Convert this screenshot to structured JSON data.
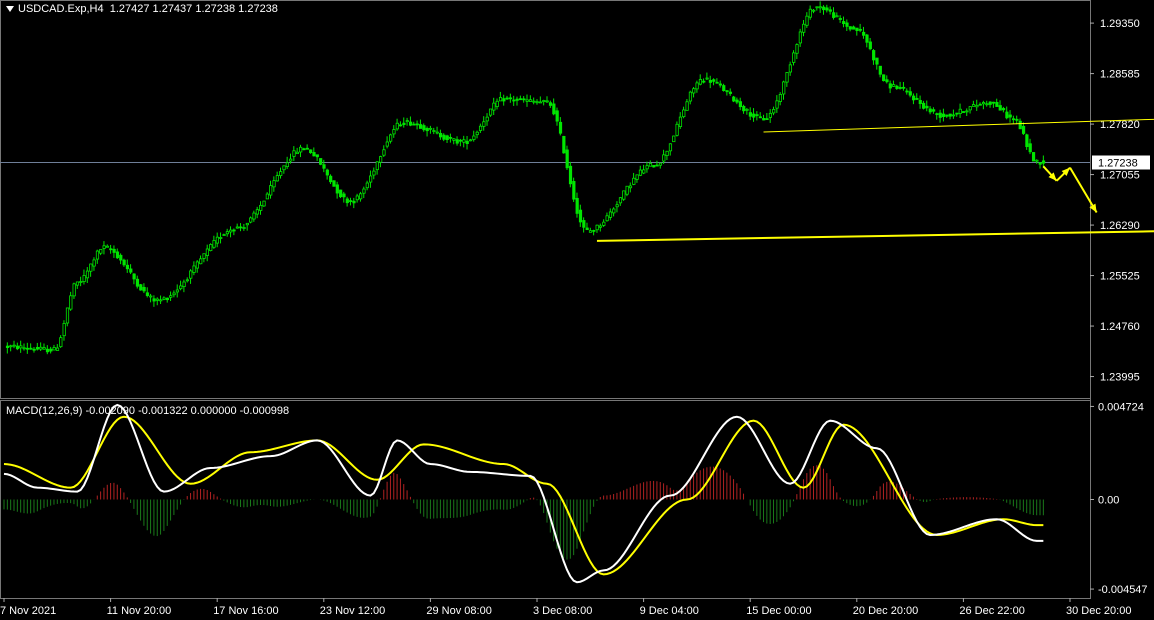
{
  "header": {
    "symbol": "USDCAD.Exp,H4",
    "ohlc": "1.27427 1.27437 1.27238 1.27238"
  },
  "macd_header": {
    "label": "MACD(12,26,9)",
    "values": "-0.002090 -0.001322 0.000000 -0.000998"
  },
  "colors": {
    "background": "#000000",
    "bull": "#00e600",
    "bear": "#00e600",
    "macd_line": "#ffffff",
    "signal_line": "#ffff00",
    "hist_pos": "#b22222",
    "hist_neg": "#1a7a1a",
    "annotation": "#ffff00",
    "price_line": "#6f7f99",
    "axis_text": "#ffffff"
  },
  "chart_data": [
    {
      "type": "candlestick",
      "title": "USDCAD.Exp,H4",
      "ylim": [
        1.2367,
        1.297
      ],
      "y_ticks": [
        "1.29350",
        "1.28585",
        "1.27820",
        "1.27055",
        "1.26290",
        "1.25525",
        "1.24760",
        "1.23995"
      ],
      "x_ticks": [
        "7 Nov 2021",
        "11 Nov 20:00",
        "17 Nov 16:00",
        "23 Nov 12:00",
        "29 Nov 08:00",
        "3 Dec 08:00",
        "9 Dec 04:00",
        "15 Dec 00:00",
        "20 Dec 20:00",
        "26 Dec 22:00",
        "30 Dec 20:00"
      ],
      "current_price": "1.27238",
      "anchors": [
        {
          "i": 0,
          "p": 1.2445
        },
        {
          "i": 15,
          "p": 1.244
        },
        {
          "i": 22,
          "p": 1.2542
        },
        {
          "i": 30,
          "p": 1.2595
        },
        {
          "i": 46,
          "p": 1.2515
        },
        {
          "i": 70,
          "p": 1.2625
        },
        {
          "i": 90,
          "p": 1.2745
        },
        {
          "i": 104,
          "p": 1.2665
        },
        {
          "i": 120,
          "p": 1.2785
        },
        {
          "i": 138,
          "p": 1.2755
        },
        {
          "i": 150,
          "p": 1.282
        },
        {
          "i": 163,
          "p": 1.2815
        },
        {
          "i": 175,
          "p": 1.262
        },
        {
          "i": 195,
          "p": 1.272
        },
        {
          "i": 210,
          "p": 1.285
        },
        {
          "i": 228,
          "p": 1.279
        },
        {
          "i": 244,
          "p": 1.296
        },
        {
          "i": 256,
          "p": 1.2925
        },
        {
          "i": 266,
          "p": 1.284
        },
        {
          "i": 282,
          "p": 1.2795
        },
        {
          "i": 296,
          "p": 1.2815
        },
        {
          "i": 303,
          "p": 1.279
        },
        {
          "i": 310,
          "p": 1.2725
        }
      ],
      "annotations": [
        {
          "kind": "trendline",
          "from": [
            228,
            1.277
          ],
          "to": [
            350,
            1.279
          ]
        },
        {
          "kind": "trendline",
          "from": [
            178,
            1.2605
          ],
          "to": [
            350,
            1.262
          ],
          "arrow": true
        },
        {
          "kind": "arrow",
          "from": [
            312,
            1.2718
          ],
          "to": [
            316,
            1.2696
          ]
        },
        {
          "kind": "arrow",
          "from": [
            316,
            1.2696
          ],
          "to": [
            320,
            1.2716
          ]
        },
        {
          "kind": "arrow",
          "from": [
            320,
            1.2716
          ],
          "to": [
            328,
            1.2648
          ]
        }
      ]
    },
    {
      "type": "macd",
      "title": "MACD(12,26,9)",
      "ylim": [
        -0.005,
        0.005
      ],
      "y_ticks": [
        "0.004724",
        "0.00",
        "-0.004547"
      ],
      "macd_anchors": [
        {
          "i": 0,
          "v": 0.0013
        },
        {
          "i": 10,
          "v": 0.0006
        },
        {
          "i": 22,
          "v": 0.0004
        },
        {
          "i": 34,
          "v": 0.0048
        },
        {
          "i": 48,
          "v": 0.0004
        },
        {
          "i": 62,
          "v": 0.0016
        },
        {
          "i": 80,
          "v": 0.0022
        },
        {
          "i": 94,
          "v": 0.003
        },
        {
          "i": 110,
          "v": 0.0002
        },
        {
          "i": 118,
          "v": 0.003
        },
        {
          "i": 128,
          "v": 0.0018
        },
        {
          "i": 140,
          "v": 0.0014
        },
        {
          "i": 158,
          "v": 0.0012
        },
        {
          "i": 172,
          "v": -0.0042
        },
        {
          "i": 180,
          "v": -0.0036
        },
        {
          "i": 200,
          "v": 0.0002
        },
        {
          "i": 220,
          "v": 0.0042
        },
        {
          "i": 236,
          "v": 0.0008
        },
        {
          "i": 248,
          "v": 0.004
        },
        {
          "i": 262,
          "v": 0.0026
        },
        {
          "i": 278,
          "v": -0.0018
        },
        {
          "i": 298,
          "v": -0.001
        },
        {
          "i": 310,
          "v": -0.0021
        }
      ],
      "signal_anchors": [
        {
          "i": 0,
          "v": 0.0018
        },
        {
          "i": 20,
          "v": 0.0006
        },
        {
          "i": 36,
          "v": 0.0042
        },
        {
          "i": 56,
          "v": 0.0008
        },
        {
          "i": 74,
          "v": 0.0024
        },
        {
          "i": 94,
          "v": 0.003
        },
        {
          "i": 112,
          "v": 0.001
        },
        {
          "i": 126,
          "v": 0.0028
        },
        {
          "i": 150,
          "v": 0.0018
        },
        {
          "i": 163,
          "v": 0.0008
        },
        {
          "i": 180,
          "v": -0.0038
        },
        {
          "i": 205,
          "v": 0.0
        },
        {
          "i": 225,
          "v": 0.004
        },
        {
          "i": 240,
          "v": 0.0006
        },
        {
          "i": 252,
          "v": 0.0038
        },
        {
          "i": 280,
          "v": -0.0018
        },
        {
          "i": 300,
          "v": -0.001
        },
        {
          "i": 310,
          "v": -0.0013
        }
      ]
    }
  ]
}
